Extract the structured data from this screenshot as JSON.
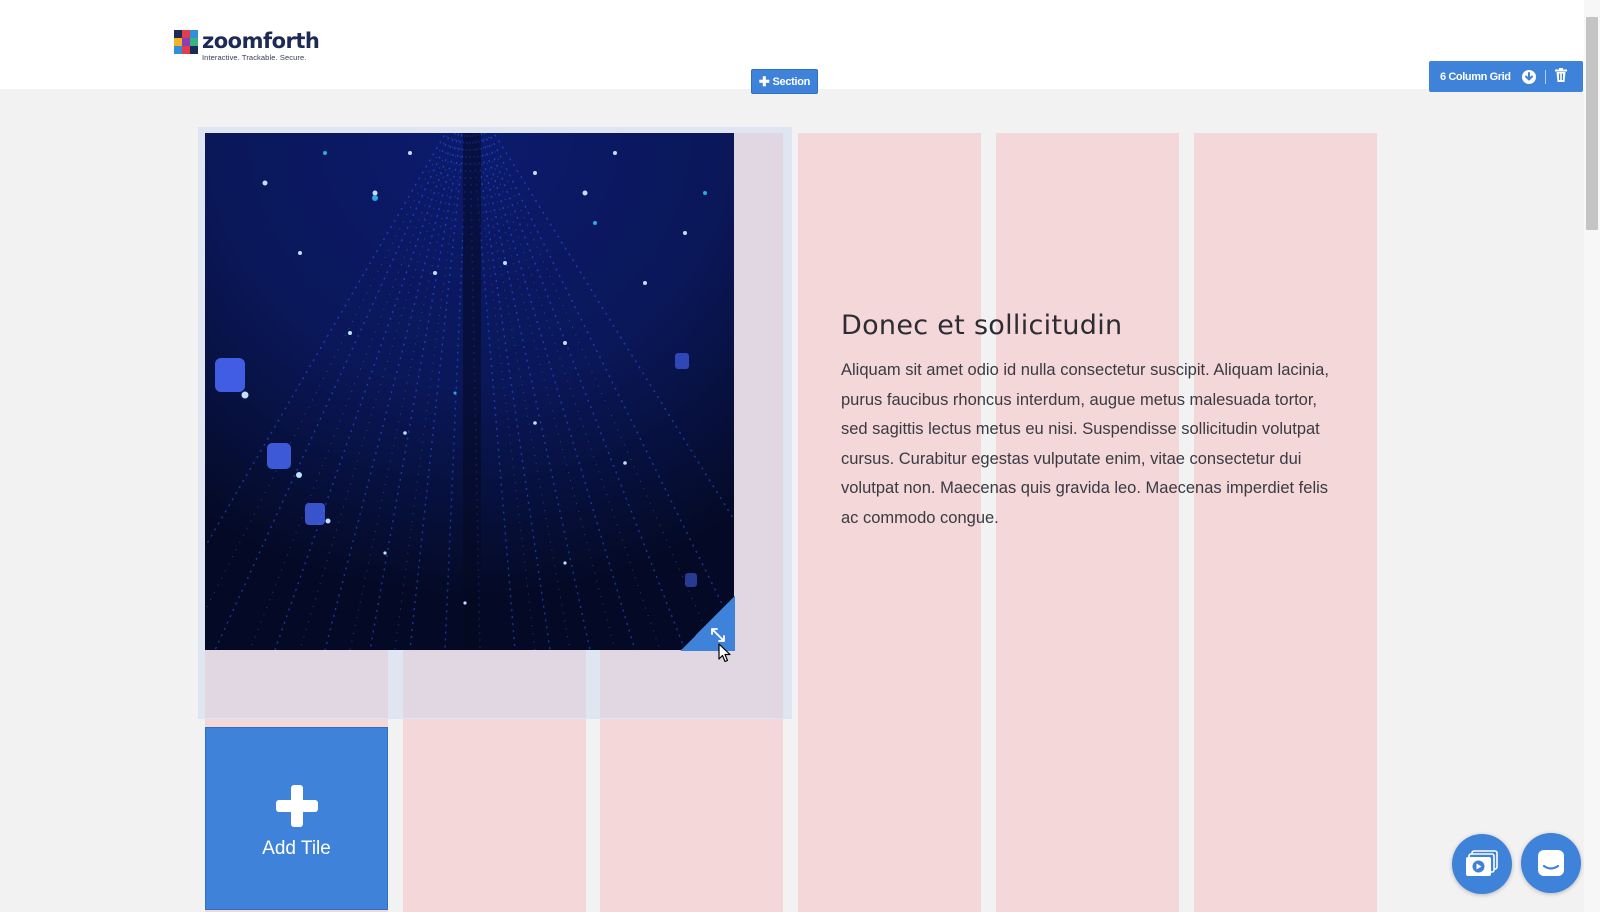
{
  "app": {
    "logo": {
      "name": "zoomforth",
      "tagline": "Interactive. Trackable. Secure."
    }
  },
  "toolbar": {
    "add_section_label": "Section",
    "grid_label": "6 Column Grid"
  },
  "content": {
    "title": "Donec et sollicitudin",
    "body": "Aliquam sit amet odio id nulla consectetur suscipit. Aliquam lacinia, purus faucibus rhoncus interdum, augue metus malesuada tortor, sed sagittis lectus metus eu nisi. Suspendisse sollicitudin volutpat cursus. Curabitur egestas vulputate enim, vitae consectetur dui volutpat non. Maecenas quis gravida leo. Maecenas imperdiet felis ac commodo congue."
  },
  "add_tile": {
    "label": "Add Tile"
  },
  "colors": {
    "accent": "#3f82d9",
    "column_guide": "#f4d7d8",
    "image_bg": "#061035"
  },
  "icons": [
    "plus-icon",
    "download-circle-icon",
    "trash-icon",
    "resize-icon",
    "cursor-icon",
    "video-library-icon",
    "chat-icon"
  ]
}
